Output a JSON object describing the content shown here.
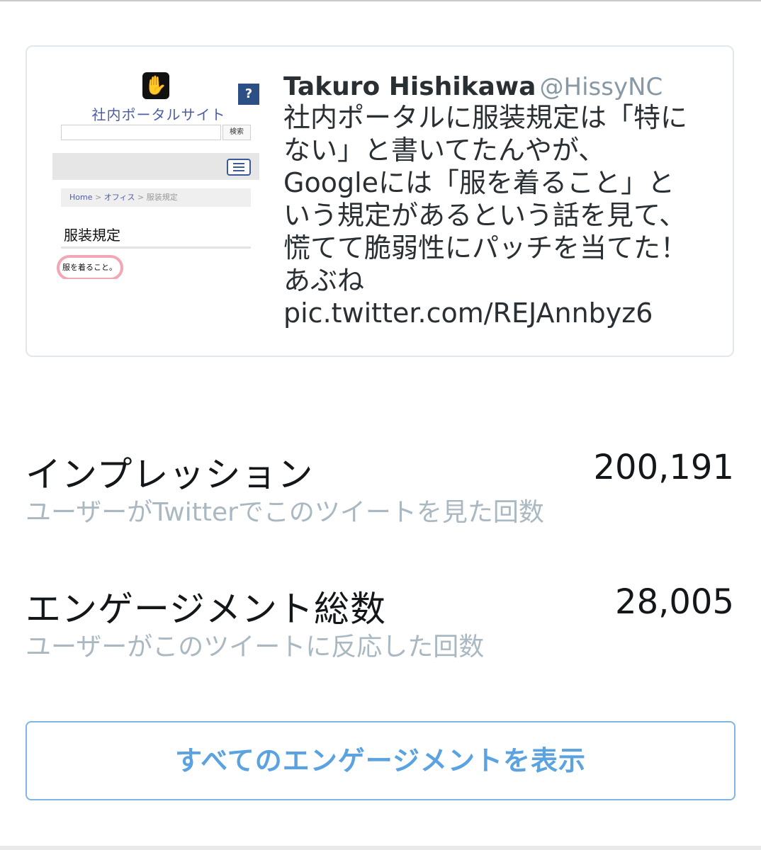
{
  "tweet": {
    "author_name": "Takuro Hishikawa",
    "author_handle": "@HissyNC",
    "body_lines": [
      "社内ポータルに服装規定は「特に",
      "ない」と書いてたんやが、",
      "Googleには「服を着ること」と",
      "いう規定があるという話を見て、",
      "慌てて脆弱性にパッチを当てた！",
      "あぶね"
    ],
    "link": "pic.twitter.com/REJAnnbyz6",
    "thumbnail": {
      "logo_icon": "hand-logo-icon",
      "help_icon": "?",
      "site_title": "社内ポータルサイト",
      "search_button": "検索",
      "breadcrumb": {
        "home": "Home",
        "sep1": " > ",
        "office": "オフィス",
        "sep2": " > ",
        "current": "服装規定"
      },
      "page_heading": "服装規定",
      "dress_code_text": "服を着ること。"
    }
  },
  "metrics": {
    "impressions": {
      "label": "インプレッション",
      "value": "200,191",
      "description": "ユーザーがTwitterでこのツイートを見た回数"
    },
    "engagements": {
      "label": "エンゲージメント総数",
      "value": "28,005",
      "description": "ユーザーがこのツイートに反応した回数"
    }
  },
  "view_all_button": "すべてのエンゲージメントを表示",
  "colors": {
    "accent": "#5aa2e0",
    "muted_text": "#aab8c2",
    "card_border": "#e1e8ed"
  }
}
